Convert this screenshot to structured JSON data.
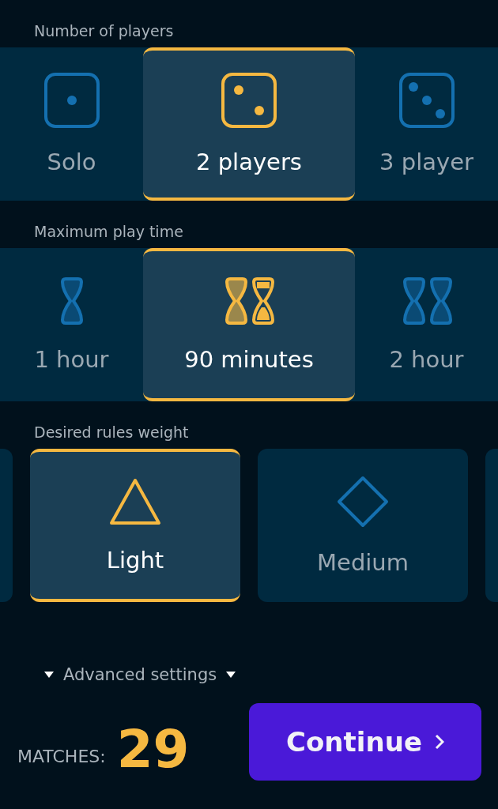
{
  "sections": [
    {
      "label": "Number of players",
      "kind": "strip",
      "options": [
        {
          "label": "Solo",
          "kind": "die1",
          "selected": false
        },
        {
          "label": "2 players",
          "kind": "die2",
          "selected": true
        },
        {
          "label": "3 player",
          "kind": "die3",
          "selected": false
        }
      ]
    },
    {
      "label": "Maximum play time",
      "kind": "strip",
      "options": [
        {
          "label": "1 hour",
          "kind": "glass1",
          "selected": false
        },
        {
          "label": "90 minutes",
          "kind": "glass2",
          "selected": true
        },
        {
          "label": "2 hour",
          "kind": "glass3",
          "selected": false
        }
      ]
    },
    {
      "label": "Desired rules weight",
      "kind": "cards",
      "options": [
        {
          "label": "Light",
          "kind": "triangle",
          "selected": true
        },
        {
          "label": "Medium",
          "kind": "diamond",
          "selected": false
        }
      ]
    }
  ],
  "advanced": {
    "label": "Advanced settings"
  },
  "footer": {
    "matches_label": "MATCHES:",
    "matches": "29",
    "button": "Continue"
  }
}
